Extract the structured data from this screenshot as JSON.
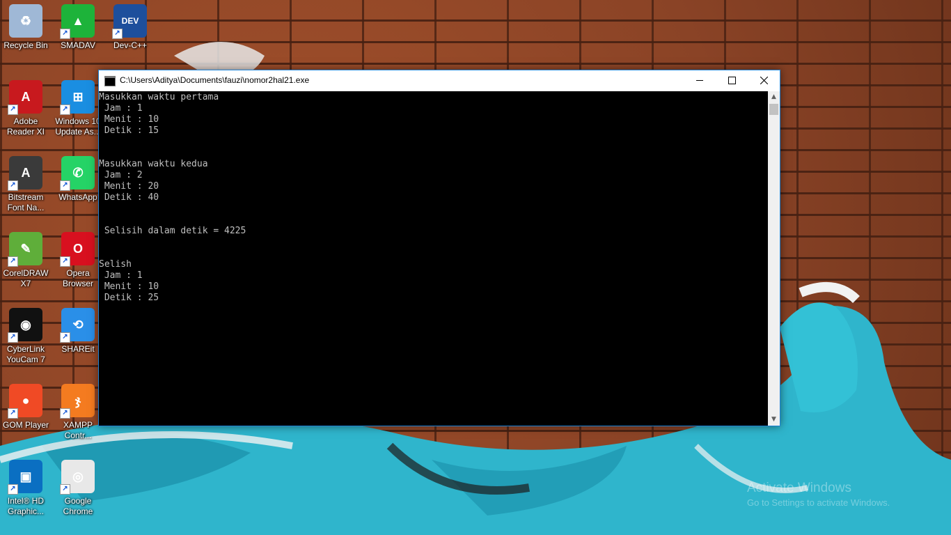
{
  "desktop": {
    "icons": [
      {
        "label": "Recycle Bin",
        "icon": "recycle-bin-icon",
        "color": "#9fb8d6",
        "glyph": "♻"
      },
      {
        "label": "SMADAV",
        "icon": "smadav-icon",
        "color": "#1db33a",
        "glyph": "▲"
      },
      {
        "label": "Dev-C++",
        "icon": "devcpp-icon",
        "color": "#1d4f9c",
        "glyph": "DEV"
      },
      {
        "label": "Adobe\nReader XI",
        "icon": "adobe-reader-icon",
        "color": "#c8191e",
        "glyph": "A"
      },
      {
        "label": "Windows 10\nUpdate As...",
        "icon": "windows-update-icon",
        "color": "#1a8ee1",
        "glyph": "⊞"
      },
      {
        "label": "Bitstream\nFont Na...",
        "icon": "bitstream-font-icon",
        "color": "#3a3a3a",
        "glyph": "A"
      },
      {
        "label": "WhatsApp",
        "icon": "whatsapp-icon",
        "color": "#25d366",
        "glyph": "✆"
      },
      {
        "label": "CorelDRAW\nX7",
        "icon": "coreldraw-icon",
        "color": "#5fae3a",
        "glyph": "✎"
      },
      {
        "label": "Opera\nBrowser",
        "icon": "opera-icon",
        "color": "#d8101f",
        "glyph": "O"
      },
      {
        "label": "CyberLink\nYouCam 7",
        "icon": "youcam-icon",
        "color": "#111111",
        "glyph": "◉"
      },
      {
        "label": "SHAREit",
        "icon": "shareit-icon",
        "color": "#2a8fe8",
        "glyph": "⟲"
      },
      {
        "label": "GOM Player",
        "icon": "gom-player-icon",
        "color": "#f04a25",
        "glyph": "●"
      },
      {
        "label": "XAMPP\nContr...",
        "icon": "xampp-icon",
        "color": "#f47b20",
        "glyph": "ჯ"
      },
      {
        "label": "Intel® HD\nGraphic...",
        "icon": "intel-graphics-icon",
        "color": "#0a6fc2",
        "glyph": "▣"
      },
      {
        "label": "Google\nChrome",
        "icon": "chrome-icon",
        "color": "#e8e8e8",
        "glyph": "◎"
      }
    ]
  },
  "window": {
    "title": "C:\\Users\\Aditya\\Documents\\fauzi\\nomor2hal21.exe",
    "minimize_label": "Minimize",
    "maximize_label": "Maximize",
    "close_label": "Close",
    "console_output": "Masukkan waktu pertama\n Jam : 1\n Menit : 10\n Detik : 15\n\n\nMasukkan waktu kedua\n Jam : 2\n Menit : 20\n Detik : 40\n\n\n Selisih dalam detik = 4225\n\n\nSelish\n Jam : 1\n Menit : 10\n Detik : 25"
  },
  "watermark": {
    "line1": "Activate Windows",
    "line2": "Go to Settings to activate Windows."
  }
}
